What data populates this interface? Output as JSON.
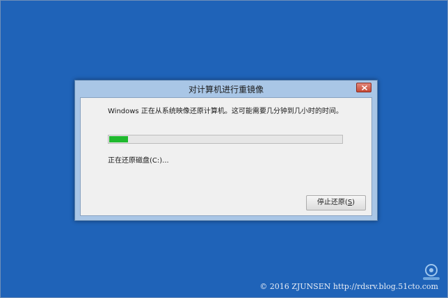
{
  "dialog": {
    "title": "对计算机进行重镜像",
    "message": "Windows 正在从系统映像还原计算机。这可能需要几分钟到几小时的时间。",
    "progress_fraction": 0.08,
    "status_text": "正在还原磁盘(C:)...",
    "stop_button": {
      "label_prefix": "停止还原(",
      "mnemonic": "S",
      "label_suffix": ")"
    }
  },
  "watermark": {
    "text": "© 2016 ZJUNSEN http://rdsrv.blog.51cto.com"
  },
  "colors": {
    "desktop_background": "#1f63b8",
    "progress_fill": "#1fb92e",
    "close_button": "#c64a36"
  }
}
